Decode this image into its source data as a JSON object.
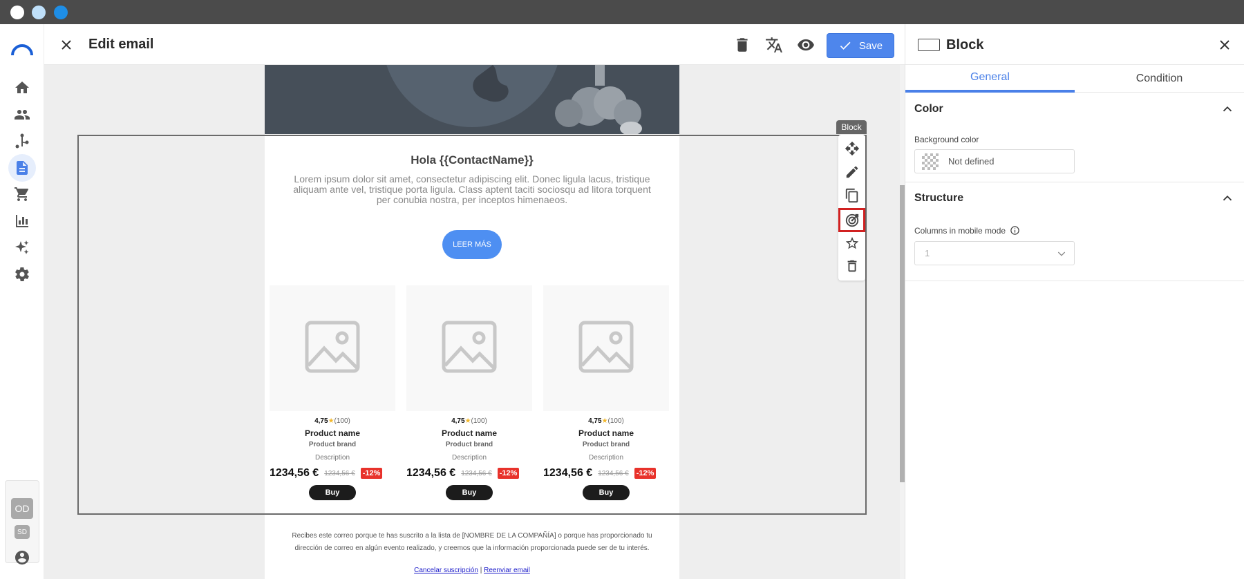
{
  "window": {
    "dots": [
      "#ffffff",
      "#bfe0fa",
      "#1e8ee6"
    ]
  },
  "header": {
    "title": "Edit email",
    "save_label": "Save"
  },
  "rail": {
    "items": [
      "home-icon",
      "contacts-icon",
      "automation-icon",
      "campaigns-icon",
      "store-icon",
      "reports-icon",
      "ai-icon",
      "settings-icon"
    ],
    "active": "campaigns-icon",
    "accounts": [
      "OD",
      "SD"
    ]
  },
  "canvas": {
    "block_tag": "Block",
    "tools": [
      "move-icon",
      "edit-icon",
      "duplicate-icon",
      "target-icon",
      "favorite-icon",
      "delete-icon"
    ],
    "highlighted_tool": "target-icon"
  },
  "email": {
    "heading": "Hola {{ContactName}}",
    "body": "Lorem ipsum dolor sit amet, consectetur adipiscing elit. Donec ligula lacus, tristique aliquam ante vel, tristique porta ligula. Class aptent taciti sociosqu ad litora torquent per conubia nostra, per inceptos himenaeos.",
    "cta": "LEER MÁS",
    "products": [
      {
        "rating": "4,75",
        "star": "★",
        "count": "(100)",
        "name": "Product name",
        "brand": "Product brand",
        "description": "Description",
        "price": "1234,56 €",
        "old_price": "1234,56 €",
        "discount": "-12%",
        "buy": "Buy"
      },
      {
        "rating": "4,75",
        "star": "★",
        "count": "(100)",
        "name": "Product name",
        "brand": "Product brand",
        "description": "Description",
        "price": "1234,56 €",
        "old_price": "1234,56 €",
        "discount": "-12%",
        "buy": "Buy"
      },
      {
        "rating": "4,75",
        "star": "★",
        "count": "(100)",
        "name": "Product name",
        "brand": "Product brand",
        "description": "Description",
        "price": "1234,56 €",
        "old_price": "1234,56 €",
        "discount": "-12%",
        "buy": "Buy"
      }
    ],
    "footer": "Recibes este correo porque te has suscrito a la lista de [NOMBRE DE LA COMPAÑÍA] o porque has proporcionado tu dirección de correo en algún evento realizado, y creemos que la información proporcionada puede ser de tu interés.",
    "unsubscribe": "Cancelar suscripción",
    "separator": "|",
    "resend": "Reenviar email"
  },
  "panel": {
    "title": "Block",
    "tabs": [
      "General",
      "Condition"
    ],
    "active_tab": "General",
    "color_section": {
      "title": "Color",
      "bg_label": "Background color",
      "bg_value": "Not defined"
    },
    "structure_section": {
      "title": "Structure",
      "columns_label": "Columns in mobile mode",
      "columns_value": "1"
    }
  }
}
